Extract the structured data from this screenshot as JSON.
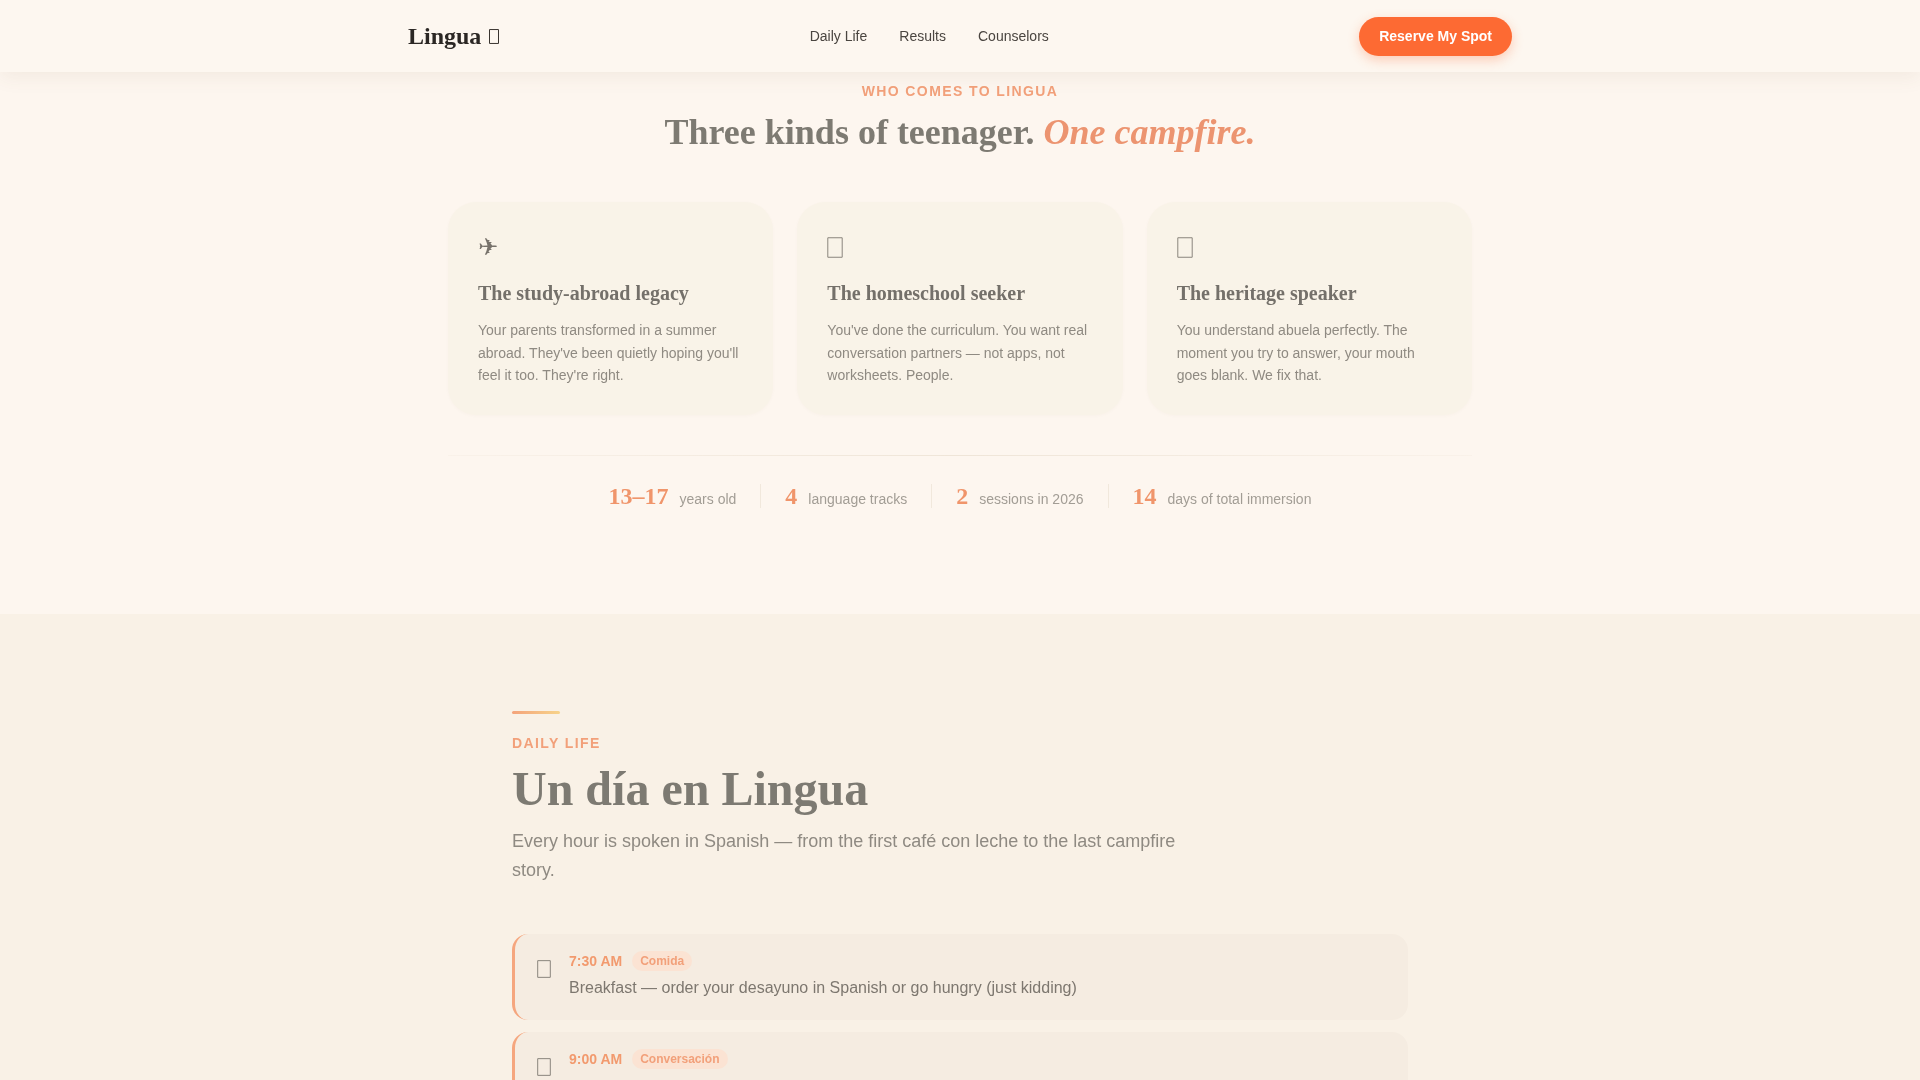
{
  "header": {
    "logo": "Lingua",
    "nav": [
      {
        "label": "Daily Life"
      },
      {
        "label": "Results"
      },
      {
        "label": "Counselors"
      }
    ],
    "cta": "Reserve My Spot"
  },
  "audience": {
    "eyebrow": "WHO COMES TO LINGUA",
    "title": "Three kinds of teenager. *One campfire.*",
    "cards": [
      {
        "glyph": "✈",
        "title": "The study-abroad legacy",
        "text": "Your parents transformed in a summer abroad. They've been quietly hoping you'll feel it too. They're right."
      },
      {
        "title": "The homeschool seeker",
        "text": "You've done the curriculum. You want real conversation partners — not apps, not worksheets. People."
      },
      {
        "title": "The heritage speaker",
        "text": "You understand abuela perfectly. The moment you try to answer, your mouth goes blank. We fix that."
      }
    ],
    "stats": [
      {
        "value": "13–17",
        "label": "years old"
      },
      {
        "value": "4",
        "label": "language tracks"
      },
      {
        "value": "2",
        "label": "sessions in 2026"
      },
      {
        "value": "14",
        "label": "days of total immersion"
      }
    ]
  },
  "daily_life": {
    "eyebrow": "DAILY LIFE",
    "title": "Un día en Lingua",
    "intro": "Every hour is spoken in Spanish — from the first café con leche to the last campfire story.",
    "schedule": [
      {
        "time": "7:30 AM",
        "tag": "Comida",
        "text": "Breakfast — order your desayuno in Spanish or go hungry (just kidding)"
      },
      {
        "time": "9:00 AM",
        "tag": "Conversación"
      }
    ]
  }
}
